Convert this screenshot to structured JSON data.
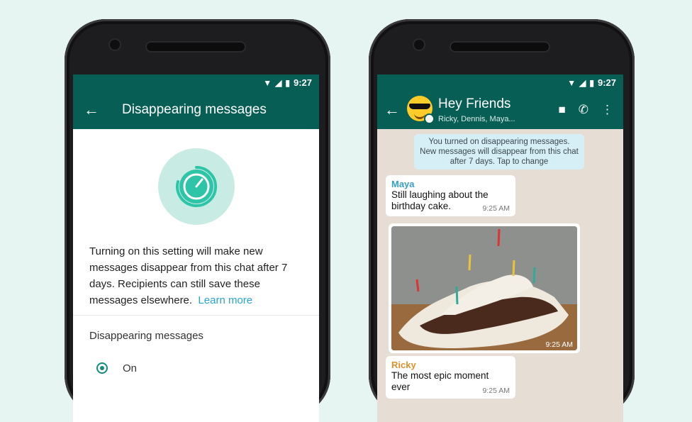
{
  "left_phone": {
    "status": {
      "time": "9:27"
    },
    "appbar": {
      "back_icon": "arrow-left-icon",
      "title": "Disappearing messages"
    },
    "description": "Turning on this setting will make new messages disappear from this chat after 7 days. Recipients can still save these messages elsewhere.",
    "learn_more": "Learn more",
    "section_label": "Disappearing messages",
    "option_on": "On"
  },
  "right_phone": {
    "status": {
      "time": "9:27"
    },
    "chat": {
      "title": "Hey Friends",
      "subtitle": "Ricky, Dennis, Maya...",
      "system_message": "You turned on disappearing messages. New messages will disappear from this chat after 7 days. Tap to change"
    },
    "messages": [
      {
        "sender": "Maya",
        "text": "Still laughing about the birthday cake.",
        "time": "9:25 AM",
        "sender_color": "#35a0c4"
      },
      {
        "type": "photo",
        "time": "9:25 AM"
      },
      {
        "sender": "Ricky",
        "text": "The most epic moment ever",
        "time": "9:25 AM",
        "sender_color": "#e0902a"
      }
    ]
  },
  "colors": {
    "accent": "#075e54",
    "teal": "#128c7e",
    "link": "#25a5d2",
    "timer_bg": "#c8ece4"
  }
}
